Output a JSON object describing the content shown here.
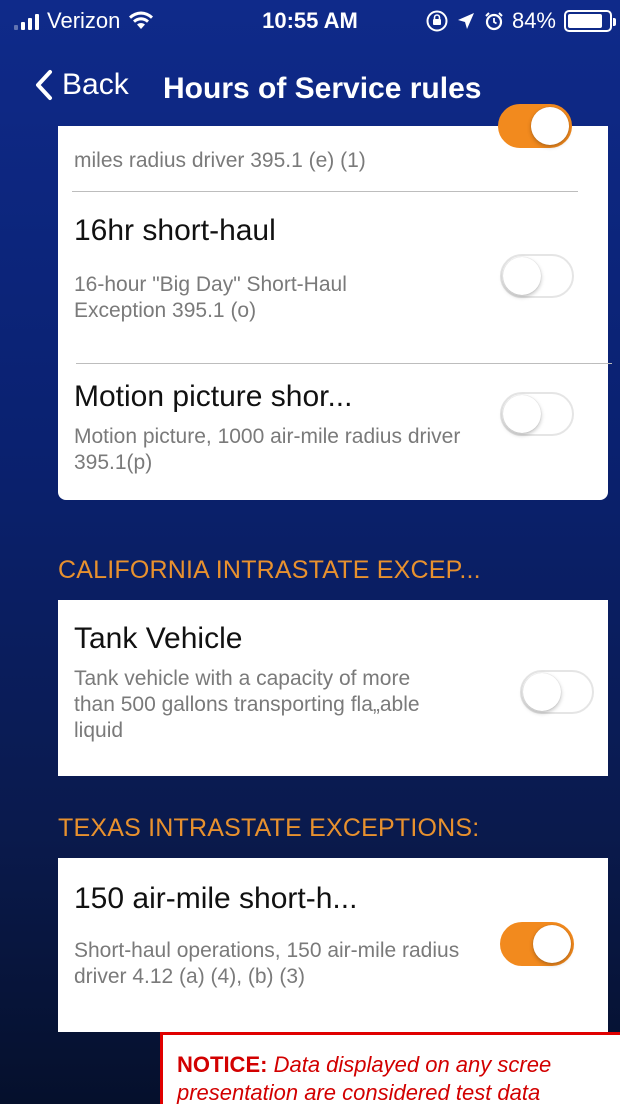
{
  "status_bar": {
    "carrier": "Verizon",
    "time": "10:55 AM",
    "battery": "84%",
    "battery_level": 0.84
  },
  "nav": {
    "back_label": "Back",
    "title": "Hours of Service rules"
  },
  "rules_card": {
    "rows": [
      {
        "title": "",
        "description": "miles radius driver 395.1 (e) (1)",
        "enabled": true
      },
      {
        "title": "16hr short-haul",
        "description": "16-hour \"Big Day\" Short-Haul Exception 395.1 (o)",
        "enabled": false
      },
      {
        "title": "Motion picture shor...",
        "description": "Motion picture, 1000 air-mile radius driver 395.1(p)",
        "enabled": false
      }
    ]
  },
  "california": {
    "header": "CALIFORNIA INTRASTATE EXCEP...",
    "rows": [
      {
        "title": "Tank Vehicle",
        "description": "Tank vehicle with a capacity of more than 500 gallons transporting fla„able liquid",
        "enabled": false
      }
    ]
  },
  "texas": {
    "header": "TEXAS INTRASTATE EXCEPTIONS:",
    "rows": [
      {
        "title": "150 air-mile short-h...",
        "description": "Short-haul operations, 150 air-mile radius driver 4.12 (a) (4), (b) (3)",
        "enabled": true
      }
    ]
  },
  "notice": {
    "label": "NOTICE:",
    "line1": "Data displayed on any scree",
    "line2": "presentation are considered test data"
  },
  "colors": {
    "accent": "#f28a1e",
    "section_header": "#e8912e",
    "background_top": "#0f2a8a",
    "background_bottom": "#05102c",
    "notice_red": "#e00000"
  }
}
